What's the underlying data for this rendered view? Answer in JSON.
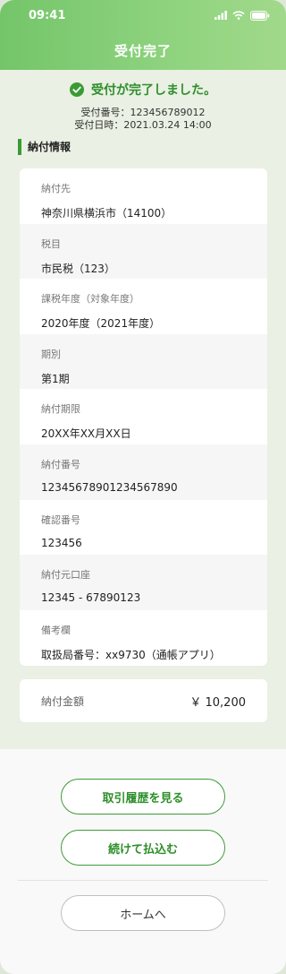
{
  "status": {
    "time": "09:41"
  },
  "header": {
    "title": "受付完了"
  },
  "completion": {
    "message": "受付が完了しました。",
    "receipt_number": "受付番号：123456789012",
    "receipt_datetime": "受付日時：2021.03.24 14:00"
  },
  "section": {
    "title": "納付情報"
  },
  "details": [
    {
      "label": "納付先",
      "value": "神奈川県横浜市（14100）"
    },
    {
      "label": "税目",
      "value": "市民税（123）"
    },
    {
      "label": "課税年度（対象年度）",
      "value": "2020年度（2021年度）"
    },
    {
      "label": "期別",
      "value": "第1期"
    },
    {
      "label": "納付期限",
      "value": "20XX年XX月XX日"
    },
    {
      "label": "納付番号",
      "value": "12345678901234567890"
    },
    {
      "label": "確認番号",
      "value": "123456"
    },
    {
      "label": "納付元口座",
      "value": "12345 - 67890123"
    },
    {
      "label": "備考欄",
      "value": "取扱局番号：xx9730（通帳アプリ）"
    }
  ],
  "total": {
    "label": "納付金額",
    "value": "￥ 10,200"
  },
  "actions": {
    "history": "取引履歴を見る",
    "continue": "続けて払込む",
    "home": "ホームへ"
  },
  "colors": {
    "accent": "#3a9b35",
    "header": "#7cc970"
  }
}
